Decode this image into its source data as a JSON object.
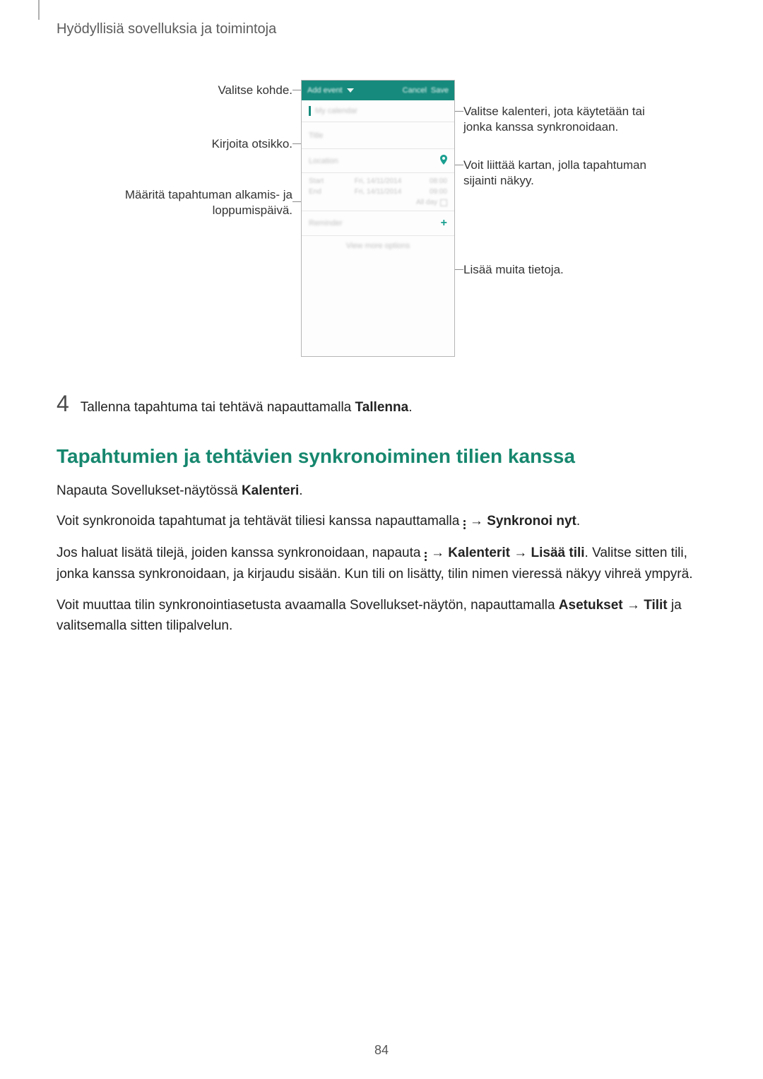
{
  "header": {
    "title": "Hyödyllisiä sovelluksia ja toimintoja"
  },
  "diagram": {
    "left": {
      "l1": "Valitse kohde.",
      "l2": "Kirjoita otsikko.",
      "l3": "Määritä tapahtuman alkamis- ja loppumispäivä."
    },
    "right": {
      "r1": "Valitse kalenteri, jota käytetään tai jonka kanssa synkronoidaan.",
      "r2": "Voit liittää kartan, jolla tapahtuman sijainti näkyy.",
      "r3": "Lisää muita tietoja."
    },
    "mock": {
      "topbar_title": "Add event",
      "topbar_cancel": "Cancel",
      "topbar_save": "Save",
      "my_calendar": "My calendar",
      "title_field": "Title",
      "location_field": "Location",
      "start": "Start",
      "end": "End",
      "date1": "Fri, 14/11/2014",
      "time1": "08:00",
      "date2": "Fri, 14/11/2014",
      "time2": "09:00",
      "allday": "All day",
      "reminder": "Reminder",
      "view_more": "View more options"
    }
  },
  "step4": {
    "num": "4",
    "text_pre": "Tallenna tapahtuma tai tehtävä napauttamalla ",
    "text_bold": "Tallenna",
    "text_post": "."
  },
  "section": {
    "heading": "Tapahtumien ja tehtävien synkronoiminen tilien kanssa",
    "p1_pre": "Napauta Sovellukset-näytössä ",
    "p1_bold": "Kalenteri",
    "p1_post": ".",
    "p2_pre": "Voit synkronoida tapahtumat ja tehtävät tiliesi kanssa napauttamalla ",
    "p2_arrow": " → ",
    "p2_bold": "Synkronoi nyt",
    "p2_post": ".",
    "p3_pre": "Jos haluat lisätä tilejä, joiden kanssa synkronoidaan, napauta ",
    "p3_arrow1": " → ",
    "p3_b1": "Kalenterit",
    "p3_arrow2": " → ",
    "p3_b2": "Lisää tili",
    "p3_post": ". Valitse sitten tili, jonka kanssa synkronoidaan, ja kirjaudu sisään. Kun tili on lisätty, tilin nimen vieressä näkyy vihreä ympyrä.",
    "p4_pre": "Voit muuttaa tilin synkronointiasetusta avaamalla Sovellukset-näytön, napauttamalla ",
    "p4_b1": "Asetukset",
    "p4_arrow": " → ",
    "p4_b2": "Tilit",
    "p4_post": " ja valitsemalla sitten tilipalvelun."
  },
  "page_number": "84"
}
